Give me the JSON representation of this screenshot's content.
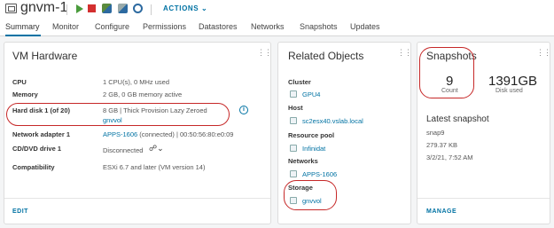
{
  "header": {
    "title": "gnvm-1",
    "actions_label": "ACTIONS",
    "icons": [
      "vm-icon",
      "power-on-icon",
      "power-off-icon",
      "console-icon",
      "migrate-icon",
      "snapshot-icon"
    ]
  },
  "tabs": [
    "Summary",
    "Monitor",
    "Configure",
    "Permissions",
    "Datastores",
    "Networks",
    "Snapshots",
    "Updates"
  ],
  "vm_hardware": {
    "title": "VM Hardware",
    "rows": [
      {
        "label": "CPU",
        "value": "1 CPU(s), 0 MHz used"
      },
      {
        "label": "Memory",
        "value": "2 GB, 0 GB memory active"
      },
      {
        "label": "Hard disk 1 (of 20)",
        "value": "8 GB | Thick Provision Lazy Zeroed",
        "value2": "gnvvol"
      },
      {
        "label": "Network adapter 1",
        "value_link": "APPS-1606",
        "value": " (connected) | 00:50:56:80:e0:09"
      },
      {
        "label": "CD/DVD drive 1",
        "value": "Disconnected"
      },
      {
        "label": "Compatibility",
        "value": "ESXi 6.7 and later (VM version 14)"
      }
    ],
    "footer": "EDIT"
  },
  "related_objects": {
    "title": "Related Objects",
    "sections": [
      {
        "label": "Cluster",
        "item": "GPU4"
      },
      {
        "label": "Host",
        "item": "sc2esx40.vslab.local"
      },
      {
        "label": "Resource pool",
        "item": "Infinidat"
      },
      {
        "label": "Networks",
        "item": "APPS-1606"
      },
      {
        "label": "Storage",
        "item": "gnvvol"
      }
    ]
  },
  "snapshots": {
    "title": "Snapshots",
    "count": "9",
    "count_label": "Count",
    "disk": "1391GB",
    "disk_label": "Disk used",
    "latest_title": "Latest snapshot",
    "latest_name": "snap9",
    "latest_size": "279.37 KB",
    "latest_date": "3/2/21, 7:52 AM",
    "footer": "MANAGE"
  },
  "colors": {
    "accent": "#0072a3",
    "highlight": "#c62828",
    "power_on": "#4a9b3c",
    "power_off": "#d32f2f"
  }
}
